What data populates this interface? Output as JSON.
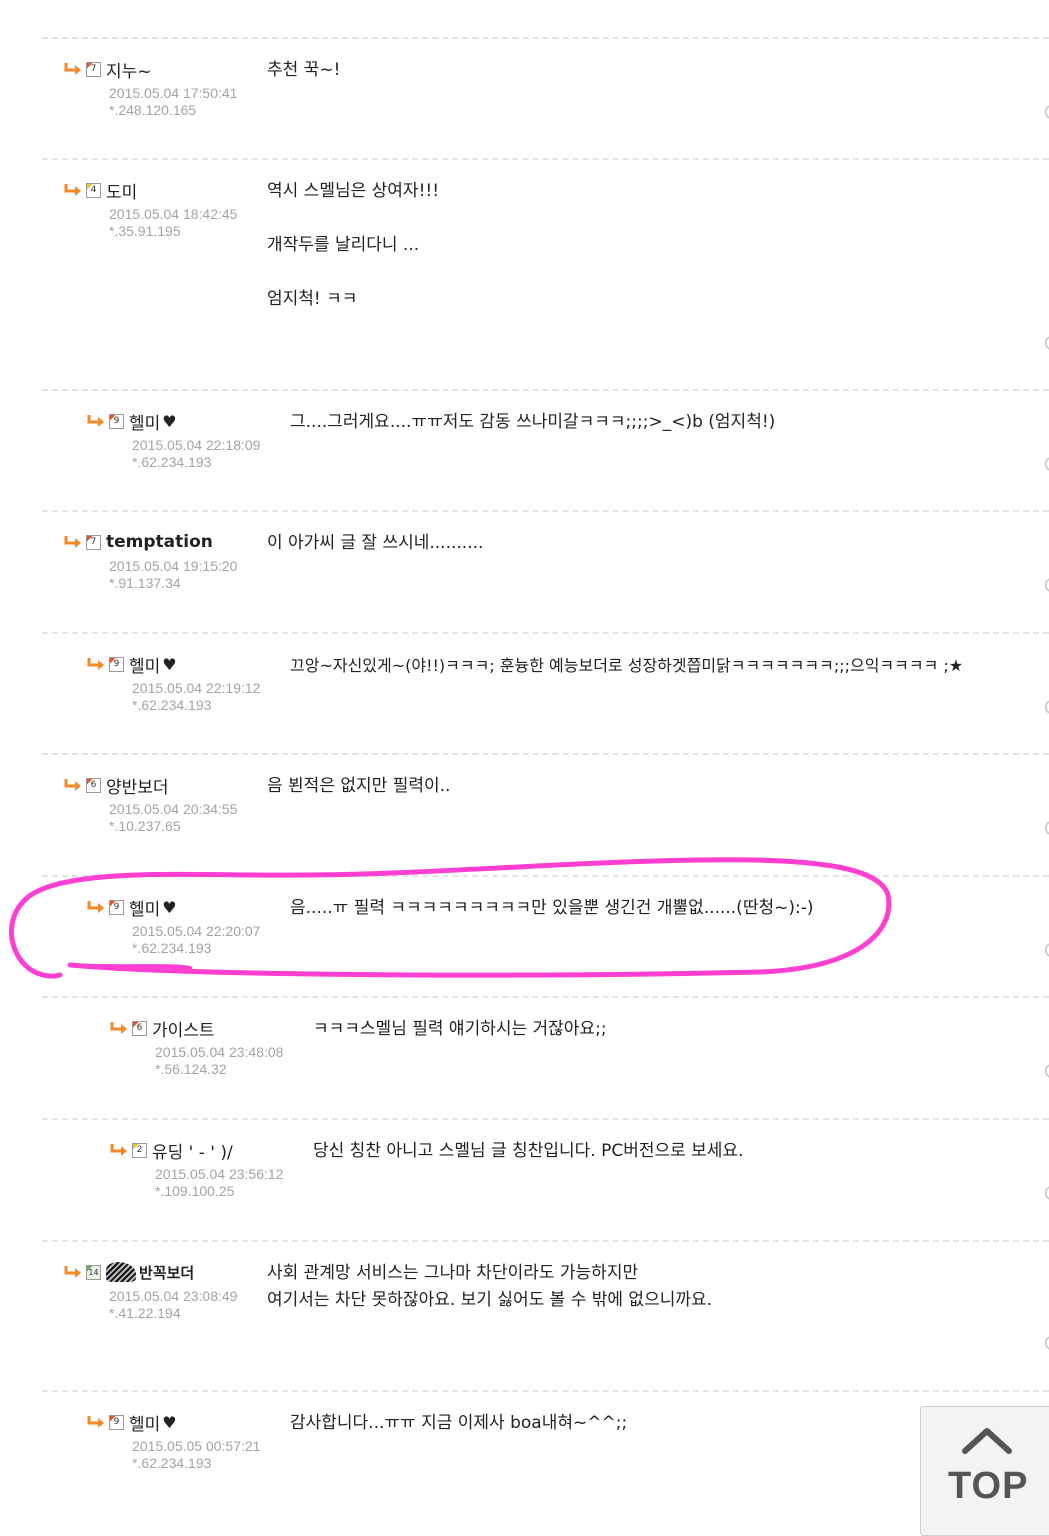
{
  "comments": [
    {
      "nick": "지누~",
      "level": "7",
      "date": "2015.05.04 17:50:41",
      "ip": "*.248.120.165",
      "lines": [
        "추천 꾹~!"
      ]
    },
    {
      "nick": "도미",
      "level": "4",
      "date": "2015.05.04 18:42:45",
      "ip": "*.35.91.195",
      "lines": [
        "역시 스멜님은 상여자!!!",
        "개작두를 날리다니 ...",
        "엄지척! ㅋㅋ"
      ]
    },
    {
      "nick": "헬미",
      "level": "9",
      "date": "2015.05.04 22:18:09",
      "ip": "*.62.234.193",
      "lines": [
        "그....그러게요....ㅠㅠ저도 감동 쓰나미갈ㅋㅋㅋ;;;;>_<)b (엄지척!)"
      ]
    },
    {
      "nick": "temptation",
      "level": "7",
      "date": "2015.05.04 19:15:20",
      "ip": "*.91.137.34",
      "lines": [
        "이 아가씨 글 잘 쓰시네.........."
      ]
    },
    {
      "nick": "헬미",
      "level": "9",
      "date": "2015.05.04 22:19:12",
      "ip": "*.62.234.193",
      "lines": [
        "끄앙~자신있게~(야!!)ㅋㅋㅋ; 훈늉한 예능보더로 성장하겟쯥미닭ㅋㅋㅋㅋㅋㅋㅋ;;;으익ㅋㅋㅋㅋ ;★"
      ]
    },
    {
      "nick": "양반보더",
      "level": "6",
      "date": "2015.05.04 20:34:55",
      "ip": "*.10.237.65",
      "lines": [
        "음 뵌적은 없지만 필력이.."
      ]
    },
    {
      "nick": "헬미",
      "level": "9",
      "date": "2015.05.04 22:20:07",
      "ip": "*.62.234.193",
      "lines": [
        "음.....ㅠ 필력 ㅋㅋㅋㅋㅋㅋㅋㅋㅋ만 있을뿐 생긴건 개뿔없......(딴청~):-)"
      ]
    },
    {
      "nick": "가이스트",
      "level": "6",
      "date": "2015.05.04 23:48:08",
      "ip": "*.56.124.32",
      "lines": [
        "ㅋㅋㅋ스멜님 필력 얘기하시는 거잖아요;;"
      ]
    },
    {
      "nick": "유딩 ' - ' )/",
      "level": "2",
      "date": "2015.05.04 23:56:12",
      "ip": "*.109.100.25",
      "lines": [
        "당신 칭찬 아니고 스멜님 글 칭찬입니다. PC버전으로 보세요."
      ]
    },
    {
      "nick": "반꼭보더",
      "level": "14",
      "date": "2015.05.04 23:08:49",
      "ip": "*.41.22.194",
      "lines": [
        "사회 관계망 서비스는 그나마 차단이라도 가능하지만",
        "여기서는 차단 못하잖아요. 보기 싫어도 볼 수 밖에 없으니까요."
      ]
    },
    {
      "nick": "헬미",
      "level": "9",
      "date": "2015.05.05 00:57:21",
      "ip": "*.62.234.193",
      "lines": [
        "감사합니다...ㅠㅠ 지금 이제사 boa내혀~^^;;"
      ]
    }
  ],
  "top_button": {
    "label": "TOP"
  },
  "colors": {
    "reply_arrow": "#f28a28",
    "highlight": "#ff3fd2",
    "meta_text": "#a3a3a3"
  },
  "icons": {
    "reply": "reply-arrow-icon",
    "level": "level-badge-icon",
    "heart": "black-heart-icon",
    "top": "chevron-up-icon"
  }
}
